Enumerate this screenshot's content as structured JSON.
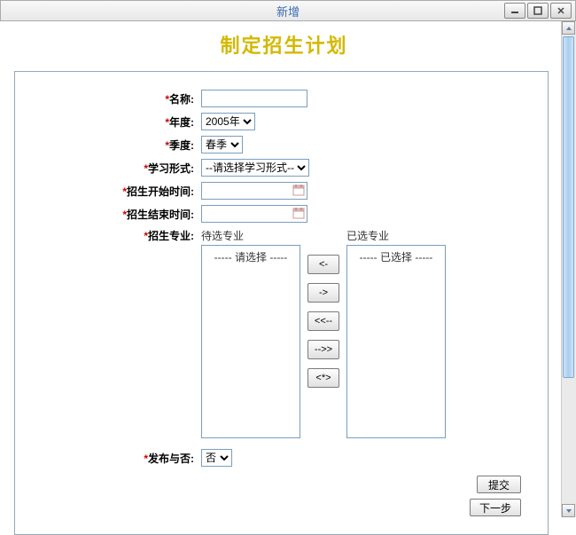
{
  "window": {
    "title": "新增"
  },
  "page": {
    "heading": "制定招生计划"
  },
  "form": {
    "name": {
      "label": "名称:",
      "value": ""
    },
    "year": {
      "label": "年度:",
      "options": [
        "2005年"
      ],
      "value": "2005年"
    },
    "quarter": {
      "label": "季度:",
      "options": [
        "春季"
      ],
      "value": "春季"
    },
    "study_mode": {
      "label": "学习形式:",
      "options": [
        "--请选择学习形式--"
      ],
      "value": "--请选择学习形式--"
    },
    "start_date": {
      "label": "招生开始时间:",
      "value": ""
    },
    "end_date": {
      "label": "招生结束时间:",
      "value": ""
    },
    "majors": {
      "label": "招生专业:",
      "available_header": "待选专业",
      "selected_header": "已选专业",
      "available_placeholder": "----- 请选择 -----",
      "selected_placeholder": "----- 已选择 -----"
    },
    "publish": {
      "label": "发布与否:",
      "options": [
        "否"
      ],
      "value": "否"
    }
  },
  "transfer_buttons": {
    "add": "<-",
    "remove": "->",
    "add_all": "<<--",
    "remove_all": "-->>",
    "swap": "<*>"
  },
  "actions": {
    "submit": "提交",
    "next": "下一步"
  }
}
